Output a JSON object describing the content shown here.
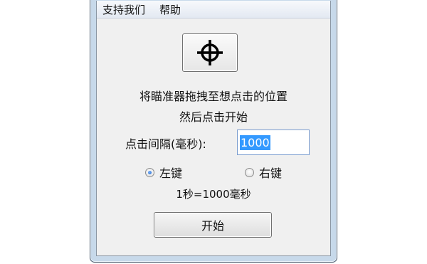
{
  "menubar": {
    "items": [
      "支持我们",
      "帮助"
    ]
  },
  "target": {
    "icon": "crosshair-icon"
  },
  "instructions": {
    "line1": "将瞄准器拖拽至想点击的位置",
    "line2": "然后点击开始"
  },
  "interval": {
    "label": "点击间隔(毫秒):",
    "value": "1000"
  },
  "mouse_button": {
    "options": [
      {
        "label": "左键",
        "checked": true
      },
      {
        "label": "右键",
        "checked": false
      }
    ]
  },
  "note": "1秒=1000毫秒",
  "start_button": {
    "label": "开始"
  },
  "colors": {
    "selection": "#3399ff",
    "frame": "#c7d9ea",
    "face": "#f0f0f0"
  }
}
